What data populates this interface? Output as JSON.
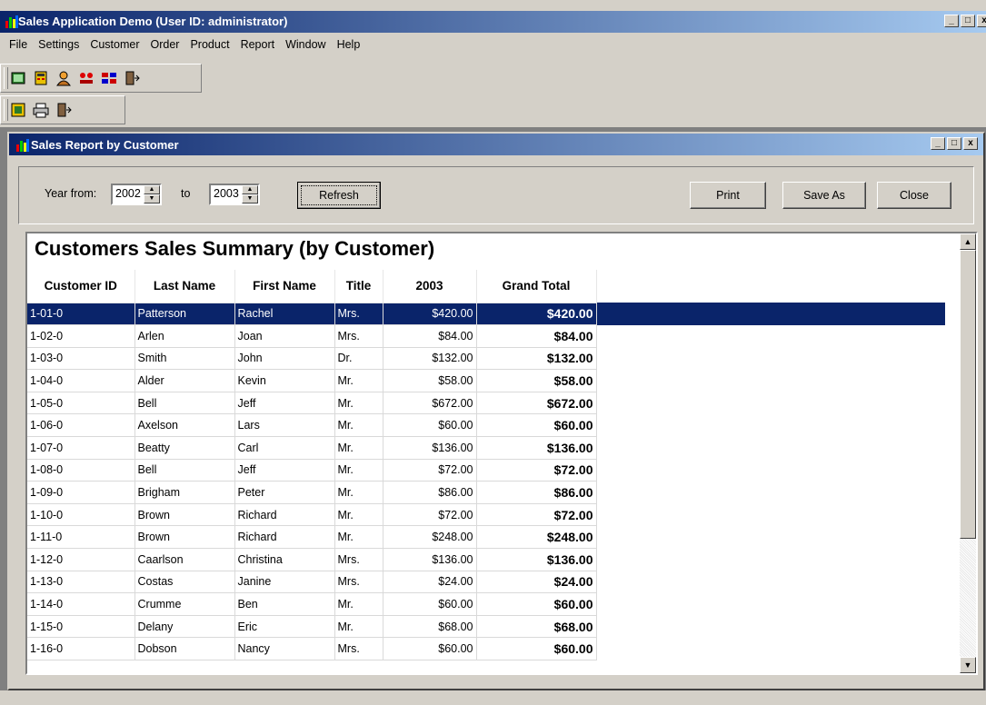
{
  "app": {
    "title": "Sales Application Demo (User ID: administrator)",
    "window_buttons": [
      "_",
      "□",
      "x"
    ]
  },
  "menu": [
    "File",
    "Settings",
    "Customer",
    "Order",
    "Product",
    "Report",
    "Window",
    "Help"
  ],
  "toolbar1_icons": [
    "open-book-icon",
    "calculator-icon",
    "customer-icon",
    "order-icon",
    "product-icon",
    "exit-door-icon"
  ],
  "toolbar2_icons": [
    "report-icon",
    "print-icon",
    "exit-door-icon"
  ],
  "child": {
    "title": "Sales Report by Customer",
    "window_buttons": [
      "_",
      "□",
      "x"
    ]
  },
  "filter": {
    "year_from_label": "Year from:",
    "year_from": "2002",
    "to_label": "to",
    "year_to": "2003",
    "refresh": "Refresh",
    "print": "Print",
    "save_as": "Save As",
    "close": "Close"
  },
  "report": {
    "title": "Customers Sales Summary (by Customer)",
    "columns": [
      "Customer ID",
      "Last Name",
      "First Name",
      "Title",
      "2003",
      "Grand Total"
    ],
    "rows": [
      [
        "1-01-0",
        "Patterson",
        "Rachel",
        "Mrs.",
        "$420.00",
        "$420.00"
      ],
      [
        "1-02-0",
        "Arlen",
        "Joan",
        "Mrs.",
        "$84.00",
        "$84.00"
      ],
      [
        "1-03-0",
        "Smith",
        "John",
        "Dr.",
        "$132.00",
        "$132.00"
      ],
      [
        "1-04-0",
        "Alder",
        "Kevin",
        "Mr.",
        "$58.00",
        "$58.00"
      ],
      [
        "1-05-0",
        "Bell",
        "Jeff",
        "Mr.",
        "$672.00",
        "$672.00"
      ],
      [
        "1-06-0",
        "Axelson",
        "Lars",
        "Mr.",
        "$60.00",
        "$60.00"
      ],
      [
        "1-07-0",
        "Beatty",
        "Carl",
        "Mr.",
        "$136.00",
        "$136.00"
      ],
      [
        "1-08-0",
        "Bell",
        "Jeff",
        "Mr.",
        "$72.00",
        "$72.00"
      ],
      [
        "1-09-0",
        "Brigham",
        "Peter",
        "Mr.",
        "$86.00",
        "$86.00"
      ],
      [
        "1-10-0",
        "Brown",
        "Richard",
        "Mr.",
        "$72.00",
        "$72.00"
      ],
      [
        "1-11-0",
        "Brown",
        "Richard",
        "Mr.",
        "$248.00",
        "$248.00"
      ],
      [
        "1-12-0",
        "Caarlson",
        "Christina",
        "Mrs.",
        "$136.00",
        "$136.00"
      ],
      [
        "1-13-0",
        "Costas",
        "Janine",
        "Mrs.",
        "$24.00",
        "$24.00"
      ],
      [
        "1-14-0",
        "Crumme",
        "Ben",
        "Mr.",
        "$60.00",
        "$60.00"
      ],
      [
        "1-15-0",
        "Delany",
        "Eric",
        "Mr.",
        "$68.00",
        "$68.00"
      ],
      [
        "1-16-0",
        "Dobson",
        "Nancy",
        "Mrs.",
        "$60.00",
        "$60.00"
      ]
    ],
    "selected_row": 0
  },
  "colors": {
    "title_bar": "#0a246a",
    "selection": "#0a246a",
    "face": "#d4d0c8"
  }
}
